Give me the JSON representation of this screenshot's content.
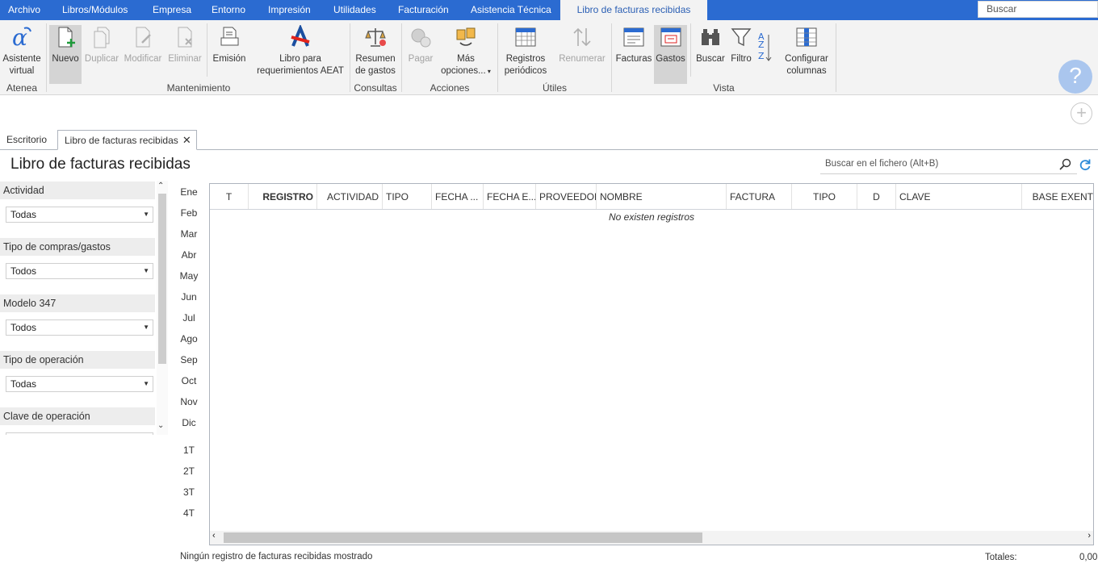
{
  "menu": {
    "items": [
      "Archivo",
      "Libros/Módulos",
      "Empresa",
      "Entorno",
      "Impresión",
      "Utilidades",
      "Facturación",
      "Asistencia Técnica"
    ],
    "active": "Libro de facturas recibidas",
    "search_placeholder": "Buscar"
  },
  "ribbon": {
    "buttons": {
      "asistente": [
        "Asistente",
        "virtual"
      ],
      "nuevo": "Nuevo",
      "duplicar": "Duplicar",
      "modificar": "Modificar",
      "eliminar": "Eliminar",
      "emision": "Emisión",
      "libro_aeat": [
        "Libro para",
        "requerimientos AEAT"
      ],
      "resumen": [
        "Resumen",
        "de gastos"
      ],
      "pagar": "Pagar",
      "mas": [
        "Más",
        "opciones..."
      ],
      "registros": [
        "Registros",
        "periódicos"
      ],
      "renumerar": "Renumerar",
      "facturas": "Facturas",
      "gastos": "Gastos",
      "buscar": "Buscar",
      "filtro": "Filtro",
      "configurar": [
        "Configurar",
        "columnas"
      ]
    },
    "groups": {
      "atenea": "Atenea",
      "mantenimiento": "Mantenimiento",
      "consultas": "Consultas",
      "acciones": "Acciones",
      "utiles": "Útiles",
      "vista": "Vista"
    }
  },
  "tabs": [
    "Escritorio",
    "Libro de facturas recibidas"
  ],
  "page": {
    "title": "Libro de facturas recibidas",
    "search_placeholder": "Buscar en el fichero (Alt+B)"
  },
  "filters": [
    {
      "label": "Actividad",
      "value": "Todas"
    },
    {
      "label": "Tipo de compras/gastos",
      "value": "Todos"
    },
    {
      "label": "Modelo 347",
      "value": "Todos"
    },
    {
      "label": "Tipo de operación",
      "value": "Todas"
    },
    {
      "label": "Clave de operación",
      "value": ""
    }
  ],
  "months": [
    "Ene",
    "Feb",
    "Mar",
    "Abr",
    "May",
    "Jun",
    "Jul",
    "Ago",
    "Sep",
    "Oct",
    "Nov",
    "Dic"
  ],
  "quarters": [
    "1T",
    "2T",
    "3T",
    "4T"
  ],
  "grid": {
    "columns": [
      "T",
      "REGISTRO",
      "ACTIVIDAD",
      "TIPO",
      "FECHA ...",
      "FECHA E...",
      "PROVEEDOR",
      "NOMBRE",
      "FACTURA",
      "TIPO",
      "D",
      "CLAVE",
      "BASE EXENT"
    ],
    "empty": "No existen registros"
  },
  "status": {
    "text": "Ningún registro de facturas recibidas mostrado",
    "totals_label": "Totales:",
    "totals_value": "0,00"
  },
  "colors": {
    "menubar": "#2b6bd1",
    "ribbon": "#f3f3f3",
    "accent": "#2b5fb4"
  }
}
